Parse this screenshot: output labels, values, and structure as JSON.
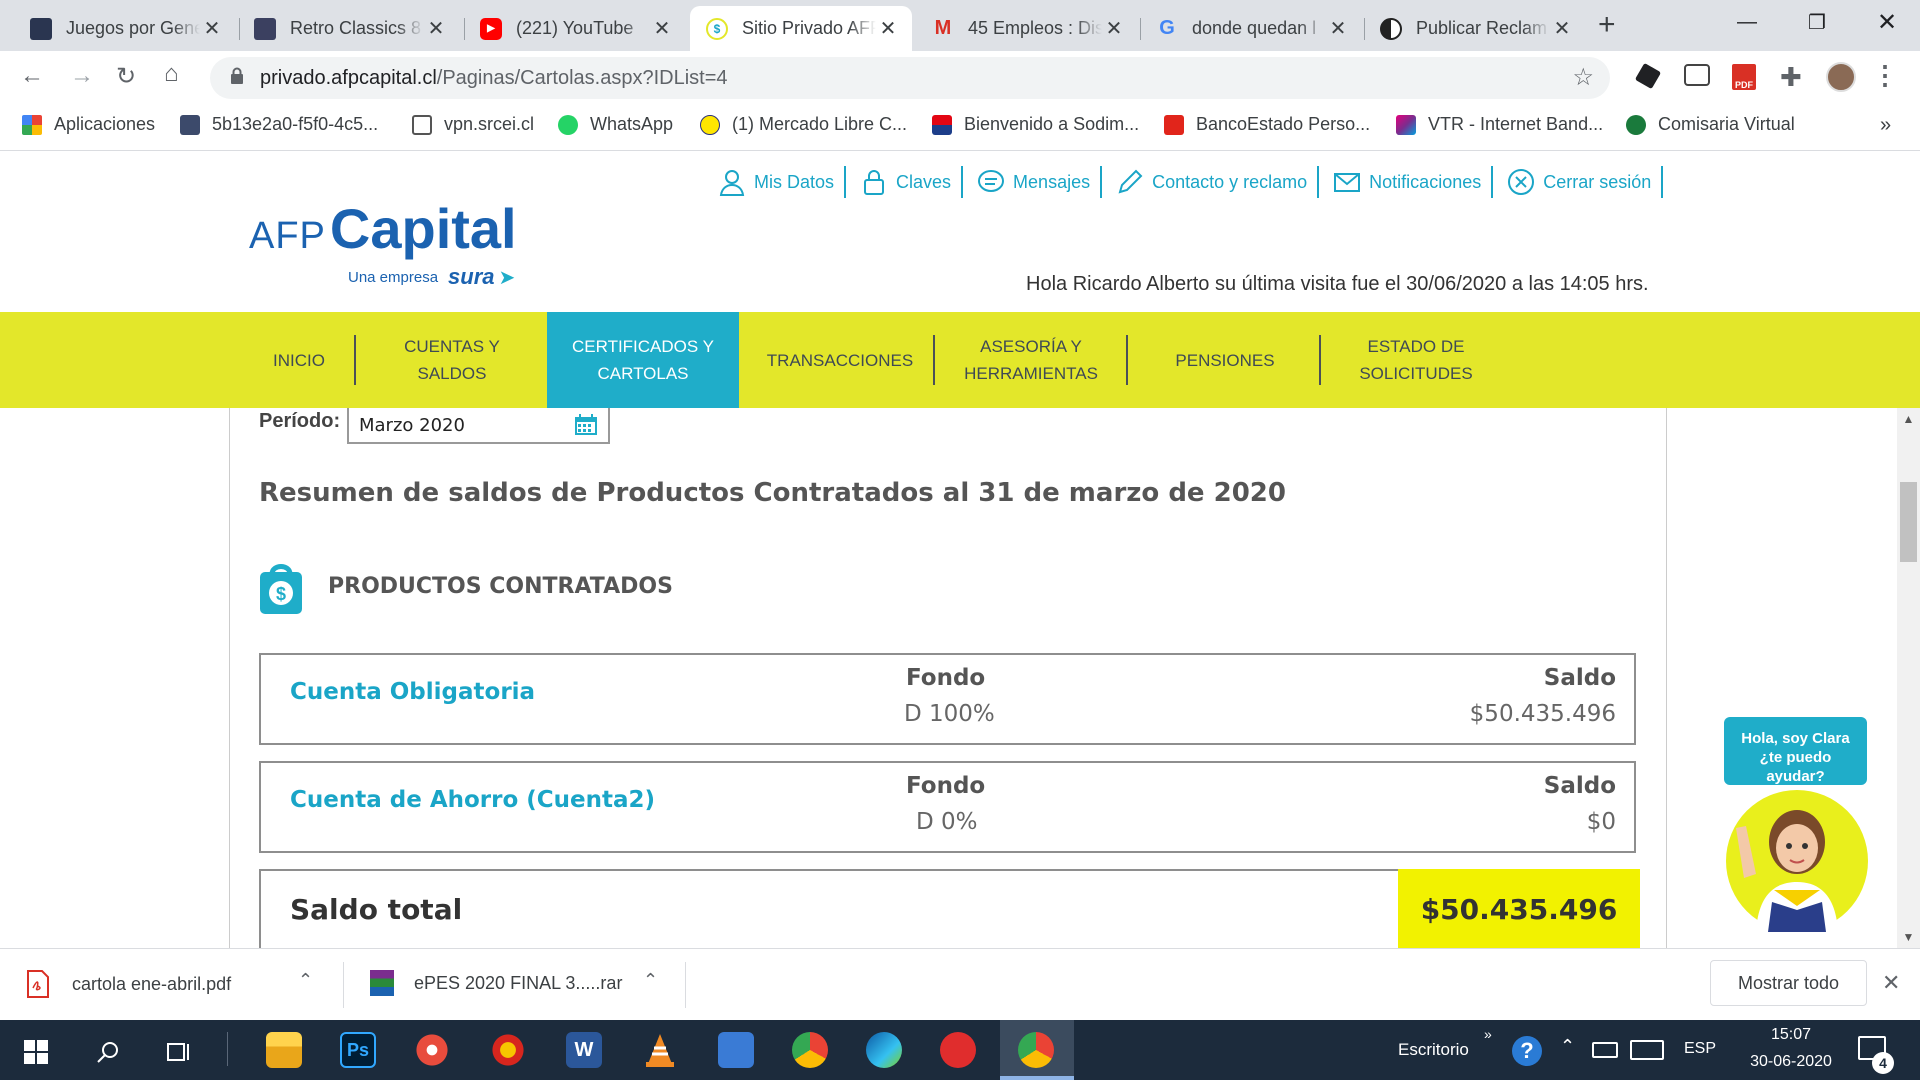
{
  "browser": {
    "tabs": [
      {
        "title": "Juegos por Gene",
        "favicon": "game-favicon",
        "color": "#223"
      },
      {
        "title": "Retro Classics 8",
        "favicon": "game-favicon",
        "color": "#334"
      },
      {
        "title": "(221) YouTube",
        "favicon": "youtube-favicon",
        "color": "#ff0000"
      },
      {
        "title": "Sitio Privado AFP",
        "favicon": "afp-favicon",
        "color": "#e3e72a"
      },
      {
        "title": "45 Empleos : Dis",
        "favicon": "gmail-favicon",
        "color": "#d93025"
      },
      {
        "title": "donde quedan l",
        "favicon": "google-favicon",
        "color": "#4285f4"
      },
      {
        "title": "Publicar Reclam",
        "favicon": "reclamos-favicon",
        "color": "#222"
      }
    ],
    "new_tab": "+",
    "url_host": "privado.afpcapital.cl",
    "url_path": "/Paginas/Cartolas.aspx?IDList=4",
    "bookmarks": [
      {
        "label": "Aplicaciones",
        "color": "#ea4335"
      },
      {
        "label": "5b13e2a0-f5f0-4c5...",
        "color": "#3c4a6b"
      },
      {
        "label": "vpn.srcei.cl",
        "color": "#555"
      },
      {
        "label": "WhatsApp",
        "color": "#25d366"
      },
      {
        "label": "(1) Mercado Libre C...",
        "color": "#ffe600"
      },
      {
        "label": "Bienvenido a Sodim...",
        "color": "#c00"
      },
      {
        "label": "BancoEstado Perso...",
        "color": "#e1251b"
      },
      {
        "label": "VTR - Internet Band...",
        "color": "#7b2d8e"
      },
      {
        "label": "Comisaria Virtual",
        "color": "#1a7a3c"
      }
    ],
    "bookmarks_more": "»"
  },
  "site": {
    "logo_afp": "AFP",
    "logo_capital": "Capital",
    "logo_tagline": "Una empresa",
    "logo_sura": "sura",
    "top_links": [
      {
        "label": "Mis Datos",
        "icon": "user-icon"
      },
      {
        "label": "Claves",
        "icon": "lock-icon"
      },
      {
        "label": "Mensajes",
        "icon": "chat-icon"
      },
      {
        "label": "Contacto y reclamo",
        "icon": "pencil-icon"
      },
      {
        "label": "Notificaciones",
        "icon": "mail-icon"
      },
      {
        "label": "Cerrar sesión",
        "icon": "close-circle-icon"
      }
    ],
    "greeting": "Hola Ricardo Alberto su última visita fue el 30/06/2020 a las 14:05 hrs.",
    "menu": [
      {
        "label": "INICIO"
      },
      {
        "label": "CUENTAS Y SALDOS"
      },
      {
        "label": "CERTIFICADOS Y CARTOLAS"
      },
      {
        "label": "TRANSACCIONES"
      },
      {
        "label": "ASESORÍA Y HERRAMIENTAS"
      },
      {
        "label": "PENSIONES"
      },
      {
        "label": "ESTADO DE SOLICITUDES"
      }
    ],
    "period_label": "Período:",
    "period_value": "Marzo 2020",
    "summary_title": "Resumen de saldos de Productos Contratados al 31 de marzo de 2020",
    "products_heading": "PRODUCTOS CONTRATADOS",
    "products": [
      {
        "name": "Cuenta Obligatoria",
        "fondo_label": "Fondo",
        "fondo": "D 100%",
        "saldo_label": "Saldo",
        "saldo": "$50.435.496"
      },
      {
        "name": "Cuenta de Ahorro (Cuenta2)",
        "fondo_label": "Fondo",
        "fondo": "D 0%",
        "saldo_label": "Saldo",
        "saldo": "$0"
      }
    ],
    "total_label": "Saldo total",
    "total_value": "$50.435.496",
    "assistant_text": "Hola, soy Clara ¿te puedo ayudar?"
  },
  "downloads": {
    "items": [
      {
        "name": "cartola ene-abril.pdf"
      },
      {
        "name": "ePES 2020 FINAL 3.....rar"
      }
    ],
    "show_all": "Mostrar todo"
  },
  "taskbar": {
    "desktop_label": "Escritorio",
    "language": "ESP",
    "time": "15:07",
    "date": "30-06-2020",
    "notifications": "4"
  }
}
